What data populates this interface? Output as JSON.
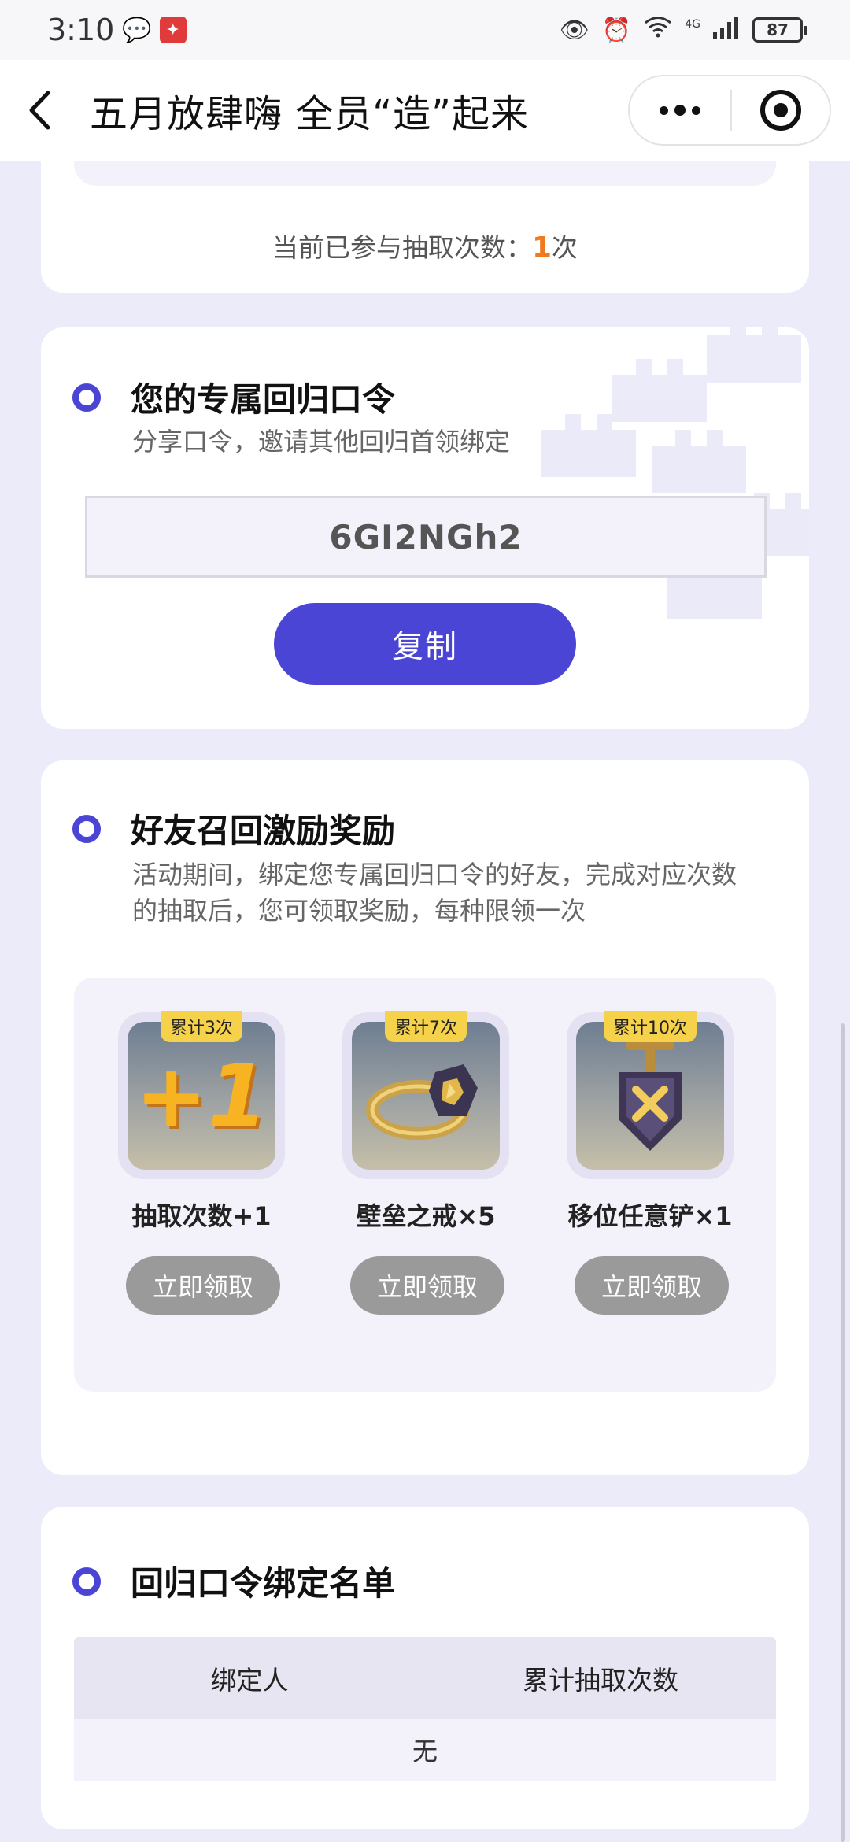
{
  "status_bar": {
    "time": "3:10",
    "battery": "87",
    "network": "4G"
  },
  "nav": {
    "title": "五月放肆嗨 全员“造”起来"
  },
  "participation": {
    "label": "当前已参与抽取次数：",
    "count": "1",
    "unit": "次"
  },
  "code_section": {
    "title": "您的专属回归口令",
    "subtitle": "分享口令，邀请其他回归首领绑定",
    "code": "6GI2NGh2",
    "copy_label": "复制"
  },
  "reward_section": {
    "title": "好友召回激励奖励",
    "subtitle_line1": "活动期间，绑定您专属回归口令的好友，完成对应次数",
    "subtitle_line2": "的抽取后，您可领取奖励，每种限领一次",
    "items": [
      {
        "tag": "累计3次",
        "name": "抽取次数+1",
        "icon": "plus-one-icon",
        "button": "立即领取"
      },
      {
        "tag": "累计7次",
        "name": "壁垒之戒×5",
        "icon": "ring-icon",
        "button": "立即领取"
      },
      {
        "tag": "累计10次",
        "name": "移位任意铲×1",
        "icon": "medal-icon",
        "button": "立即领取"
      }
    ]
  },
  "binding_section": {
    "title": "回归口令绑定名单",
    "col_binder": "绑定人",
    "col_count": "累计抽取次数",
    "empty": "无"
  },
  "colors": {
    "accent": "#4a45d4",
    "highlight": "#f07a1f",
    "background": "#ecebfa",
    "disabled_button": "#9a9a9a",
    "tag": "#f5d24a"
  }
}
